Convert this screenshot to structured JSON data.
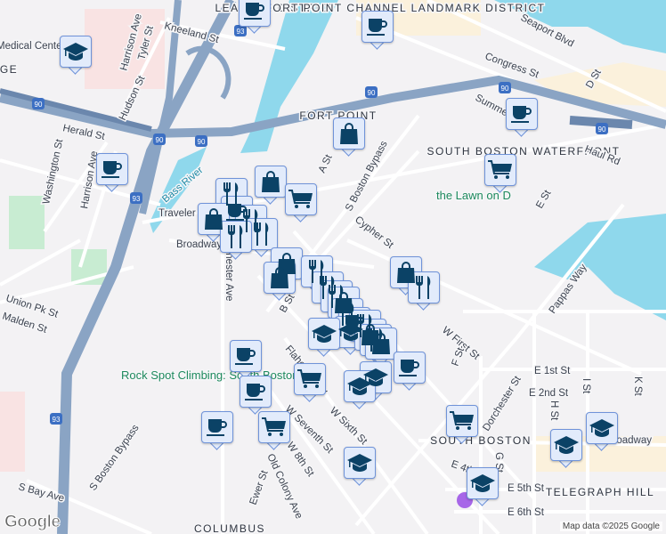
{
  "map": {
    "attribution": "Map data ©2025 Google",
    "logo": "Google",
    "districts": [
      "LEATHER DISTRICT",
      "FORT POINT CHANNEL LANDMARK DISTRICT",
      "FORT POINT",
      "SOUTH BOSTON WATERFRONT",
      "SOUTH BOSTON",
      "TELEGRAPH HILL",
      "COLUMBUS",
      "GE"
    ],
    "streets": [
      "Kneeland St",
      "Harrison Ave",
      "Tyler St",
      "Hudson St",
      "Herald St",
      "Washington St",
      "Harrison Ave",
      "Traveler St",
      "Broadway",
      "Dorchester Ave",
      "A St",
      "S Boston Bypass",
      "Cypher St",
      "Seaport Blvd",
      "Congress St",
      "Summer St",
      "D St",
      "Haul Rd",
      "E St",
      "Pappas Way",
      "W First St",
      "E 1st St",
      "E 2nd St",
      "H St",
      "I St",
      "K St",
      "Dorchester St",
      "E 4th St",
      "E 5th St",
      "E 6th St",
      "G St",
      "F St",
      "W Sixth St",
      "W Seventh St",
      "W 8th St",
      "Old Colony Ave",
      "Ewer St",
      "Union Pk St",
      "Malden St",
      "S Bay Ave",
      "S Boston Bypass",
      "B St",
      "Flaherty Way",
      "E Broadway",
      "Medical Center"
    ],
    "pois": [
      "the Lawn on D",
      "Rock Spot Climbing: South Boston"
    ],
    "water": [
      "Bass River"
    ],
    "highways": [
      "90",
      "93"
    ],
    "marker_types": {
      "cafe": "coffee-cup-icon",
      "shop": "shopping-bag-icon",
      "cart": "shopping-cart-icon",
      "restaurant": "fork-knife-icon",
      "edu": "graduation-cap-icon"
    }
  },
  "colors": {
    "water": "#8fd8ec",
    "highway": "#8aa4c4",
    "road": "#ffffff",
    "marker_bg": "#e2ebfb",
    "marker_icon": "#0b4266",
    "park": "#c8ecd2"
  }
}
